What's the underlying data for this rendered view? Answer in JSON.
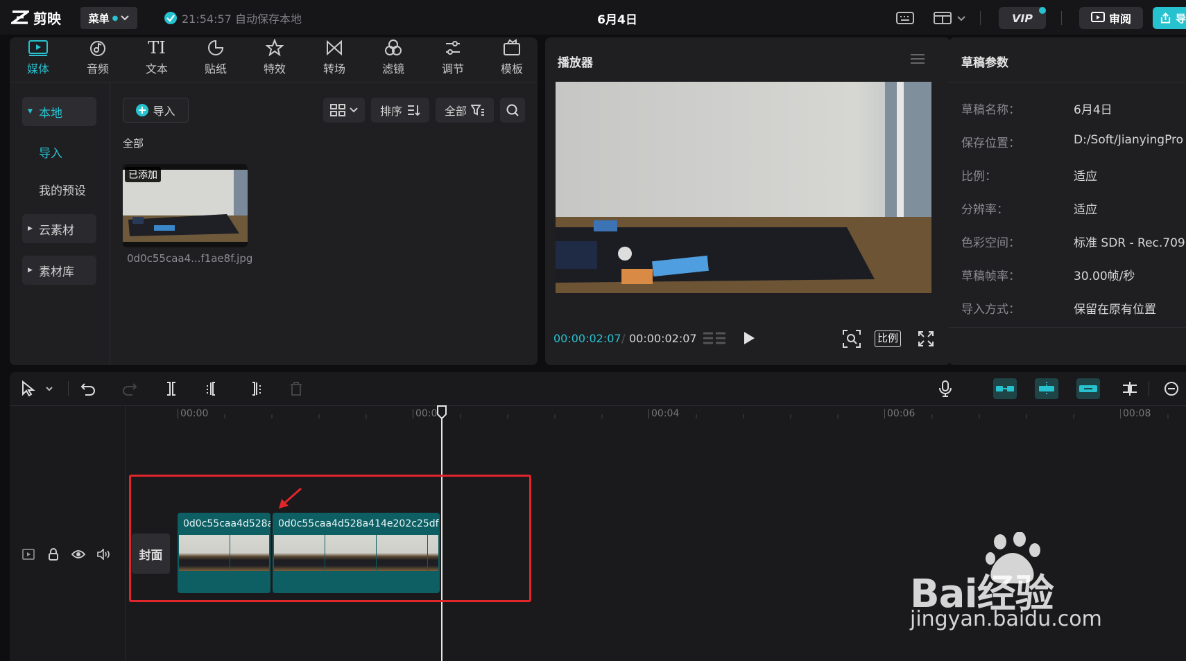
{
  "app": {
    "name": "剪映",
    "menu_label": "菜单",
    "autosave": "21:54:57 自动保存本地",
    "doc_title": "6月4日"
  },
  "topbar": {
    "vip": "VIP",
    "review": "审阅",
    "export": "导"
  },
  "tabs": [
    {
      "label": "媒体",
      "icon": "media-icon",
      "active": true
    },
    {
      "label": "音频",
      "icon": "audio-icon"
    },
    {
      "label": "文本",
      "icon": "text-icon",
      "glyph": "TI"
    },
    {
      "label": "贴纸",
      "icon": "sticker-icon"
    },
    {
      "label": "特效",
      "icon": "effects-icon"
    },
    {
      "label": "转场",
      "icon": "transition-icon"
    },
    {
      "label": "滤镜",
      "icon": "filter-icon"
    },
    {
      "label": "调节",
      "icon": "adjust-icon"
    },
    {
      "label": "模板",
      "icon": "template-icon"
    }
  ],
  "sidebar": {
    "items": [
      "本地",
      "导入",
      "我的预设",
      "云素材",
      "素材库"
    ]
  },
  "media": {
    "import_label": "导入",
    "sort_label": "排序",
    "filter_label": "全部",
    "section_label": "全部",
    "item": {
      "badge": "已添加",
      "filename": "0d0c55caa4...f1ae8f.jpg"
    }
  },
  "player": {
    "title": "播放器",
    "current_time": "00:00:02:07",
    "total_time": "00:00:02:07",
    "ratio_label": "比例"
  },
  "params": {
    "title": "草稿参数",
    "rows": [
      {
        "k": "草稿名称：",
        "v": "6月4日"
      },
      {
        "k": "保存位置：",
        "v": "D:/Soft/JianyingPro"
      },
      {
        "k": "比例：",
        "v": "适应"
      },
      {
        "k": "分辨率：",
        "v": "适应"
      },
      {
        "k": "色彩空间：",
        "v": "标准 SDR - Rec.709"
      },
      {
        "k": "草稿帧率：",
        "v": "30.00帧/秒"
      },
      {
        "k": "导入方式：",
        "v": "保留在原有位置"
      }
    ]
  },
  "timeline": {
    "ticks": [
      "00:00",
      "00:0",
      "00:04",
      "00:06",
      "00:08"
    ],
    "cover_label": "封面",
    "clips": [
      "0d0c55caa4d528a",
      "0d0c55caa4d528a414e202c25df"
    ]
  },
  "watermark": {
    "brand": "Bai经验",
    "url": "jingyan.baidu.com"
  },
  "colors": {
    "accent": "#27c2d0",
    "highlight": "#e0262a",
    "clip": "#0d5f63"
  }
}
